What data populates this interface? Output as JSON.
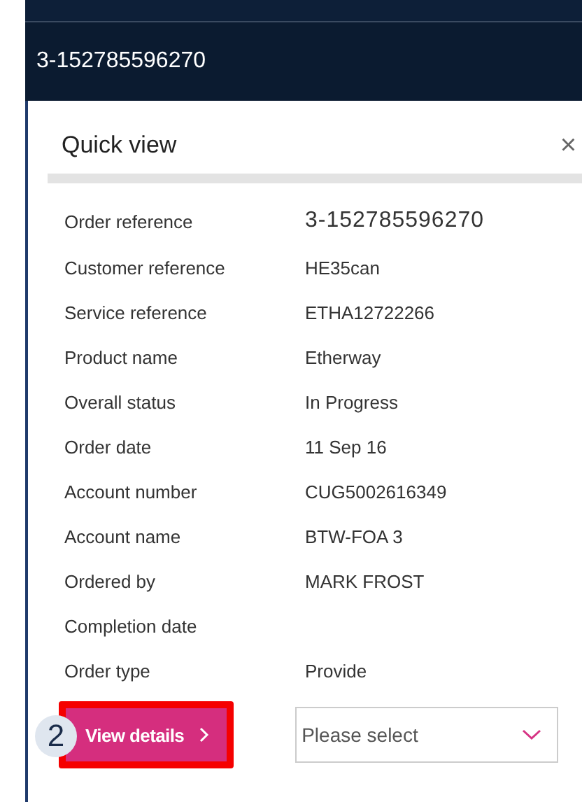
{
  "header": {
    "title": "3-152785596270"
  },
  "panel": {
    "title": "Quick view",
    "close": "×"
  },
  "fields": [
    {
      "label": "Order reference",
      "value": "3-152785596270",
      "kind": "large"
    },
    {
      "label": "Customer reference",
      "value": "HE35can",
      "kind": "normal"
    },
    {
      "label": "Service reference",
      "value": "ETHA12722266",
      "kind": "normal"
    },
    {
      "label": "Product name",
      "value": "Etherway",
      "kind": "normal"
    },
    {
      "label": "Overall status",
      "value": "In Progress",
      "kind": "normal"
    },
    {
      "label": "Order date",
      "value": "11 Sep 16",
      "kind": "normal"
    },
    {
      "label": "Account number",
      "value": "CUG5002616349",
      "kind": "normal"
    },
    {
      "label": "Account name",
      "value": "BTW-FOA 3",
      "kind": "normal"
    },
    {
      "label": "Ordered by",
      "value": "MARK FROST",
      "kind": "normal"
    },
    {
      "label": "Completion date",
      "kind": "normal"
    },
    {
      "label": "Order type",
      "value": "Provide",
      "kind": "normal"
    }
  ],
  "step_badge": "2",
  "view_button": {
    "label": "View details",
    "highlighted": true
  },
  "select": {
    "placeholder": "Please select"
  }
}
